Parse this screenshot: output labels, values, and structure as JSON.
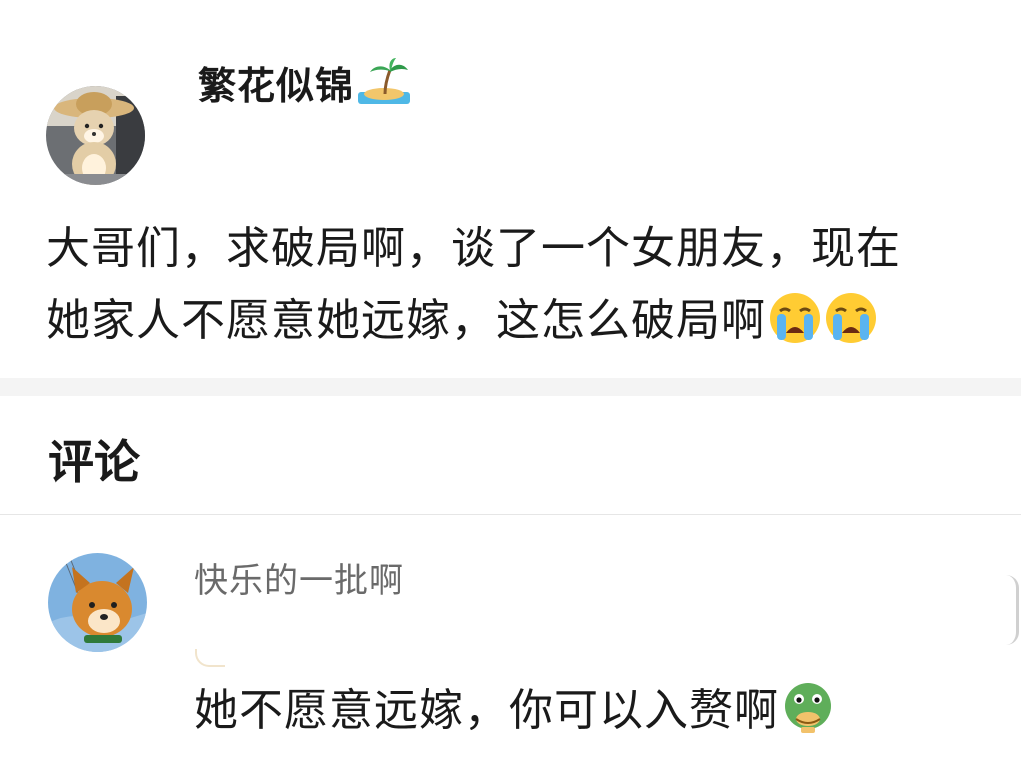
{
  "post": {
    "author": "繁花似锦",
    "author_badge": "desert-island-emoji",
    "body_line1": "大哥们，求破局啊，谈了一个女朋友，现在",
    "body_line2": "她家人不愿意她远嫁，这怎么破局啊",
    "body_emoji": [
      "loudly-crying-emoji",
      "loudly-crying-emoji"
    ]
  },
  "comments": {
    "title": "评论",
    "items": [
      {
        "user": "快乐的一批啊",
        "text": "她不愿意远嫁，你可以入赘啊",
        "emoji": "green-face-emoji"
      }
    ]
  },
  "colors": {
    "text": "#1a1a1a",
    "muted": "#6a6a6a",
    "band": "#f4f4f4"
  }
}
